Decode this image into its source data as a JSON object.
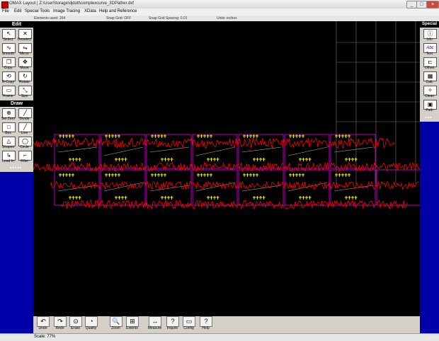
{
  "window": {
    "title": "OMAX Layout | Z:\\UserStorage\\djdott\\complexcurve_3DPather.dxf"
  },
  "menu": [
    "File",
    "Edit",
    "Special Tools",
    "Image Tracing",
    "XData",
    "Help and Reference"
  ],
  "info": {
    "elements": "Elements used: 264",
    "snap_grid": "Snap Grid: OFF",
    "snap_spacing": "Snap Grid Spacing: 0.01",
    "units": "Units: inches"
  },
  "left_palette": {
    "edit_heading": "Edit",
    "edit_tools": [
      {
        "label": "Select",
        "icon": "select-arrow-icon"
      },
      {
        "label": "Deselect",
        "icon": "deselect-icon"
      },
      {
        "label": "Smooth",
        "icon": "smooth-icon"
      },
      {
        "label": "Mirror",
        "icon": "mirror-icon"
      },
      {
        "label": "Copy",
        "icon": "copy-icon"
      },
      {
        "label": "Move",
        "icon": "move-icon"
      },
      {
        "label": "R-Copy",
        "icon": "rotate-copy-icon"
      },
      {
        "label": "Rotate",
        "icon": "rotate-icon"
      },
      {
        "label": "Frame",
        "icon": "frame-icon"
      },
      {
        "label": "Size",
        "icon": "size-icon"
      }
    ],
    "draw_heading": "Draw",
    "draw_tools": [
      {
        "label": "Set Zero",
        "icon": "set-zero-icon"
      },
      {
        "label": "Divide",
        "icon": "divide-icon"
      },
      {
        "label": "Box",
        "icon": "box-icon"
      },
      {
        "label": "Line",
        "icon": "line-icon"
      },
      {
        "label": "Shapes",
        "icon": "shapes-icon"
      },
      {
        "label": "Circle",
        "icon": "circle-icon"
      },
      {
        "label": "Lead In",
        "icon": "lead-in-icon"
      },
      {
        "label": "Fillet",
        "icon": "fillet-icon"
      }
    ]
  },
  "right_palette": {
    "heading": "Special",
    "tools": [
      {
        "label": "Info",
        "icon": "info-icon"
      },
      {
        "label": "Text",
        "icon": "text-icon",
        "glyph": "Abc"
      },
      {
        "label": "Offset",
        "icon": "offset-icon"
      },
      {
        "label": "Calc",
        "icon": "calculator-icon"
      },
      {
        "label": "Clean",
        "icon": "clean-icon"
      },
      {
        "label": "Path",
        "icon": "path-icon"
      }
    ]
  },
  "bottom_toolbar": [
    {
      "label": "Undo",
      "icon": "undo-icon"
    },
    {
      "label": "Redo",
      "icon": "redo-icon"
    },
    {
      "label": "Erase",
      "icon": "erase-icon"
    },
    {
      "label": "Quality",
      "icon": "quality-icon"
    },
    {
      "label": "Zoom",
      "icon": "zoom-icon"
    },
    {
      "label": "Extents",
      "icon": "extents-icon"
    },
    {
      "label": "Measure",
      "icon": "measure-icon"
    },
    {
      "label": "Inquire",
      "icon": "inquire-icon"
    },
    {
      "label": "Config",
      "icon": "config-icon"
    },
    {
      "label": "Help",
      "icon": "help-icon"
    }
  ],
  "status": {
    "scale": "Scale: 77%"
  },
  "colors": {
    "canvas": "#000000",
    "background": "#0000a8",
    "path_red": "#ff0000",
    "lead_yellow": "#ffff00",
    "part_magenta": "#ff00ff",
    "grid": "#707070"
  }
}
